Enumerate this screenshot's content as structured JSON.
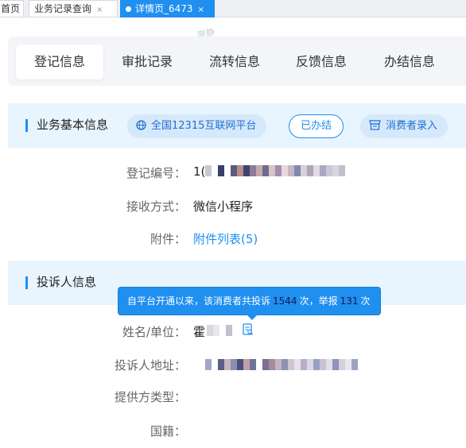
{
  "top_tabs": [
    {
      "label": "首页"
    },
    {
      "label": "业务记录查询",
      "close": "×"
    },
    {
      "label": "详情页_6473",
      "close": "×",
      "active": true
    }
  ],
  "watermark": "廖静",
  "section_tabs": [
    {
      "label": "登记信息",
      "active": true
    },
    {
      "label": "审批记录"
    },
    {
      "label": "流转信息"
    },
    {
      "label": "反馈信息"
    },
    {
      "label": "办结信息"
    }
  ],
  "business_section": {
    "title": "业务基本信息",
    "buttons": {
      "platform": "全国12315互联网平台",
      "done": "已办结",
      "consumer": "消费者录入"
    },
    "fields": {
      "reg_no_label": "登记编号：",
      "reg_no_prefix": "1(",
      "receive_label": "接收方式：",
      "receive_value": "微信小程序",
      "attach_label": "附件：",
      "attach_value": "附件列表(5)"
    }
  },
  "complainant_section": {
    "title": "投诉人信息",
    "tooltip": {
      "text_1": "自平台开通以来，该消费者共投诉",
      "complaint_count": "1544",
      "text_2": "次，举报",
      "report_count": "131",
      "text_3": "次"
    },
    "fields": {
      "name_label": "姓名/单位：",
      "name_value": "霍",
      "address_label": "投诉人地址：",
      "provider_type_label": "提供方类型：",
      "nationality_label": "国籍："
    }
  },
  "colors": {
    "accent": "#1f8ff0",
    "section_bg": "#e8f4fe",
    "tab_panel_bg": "#f3f5f8"
  }
}
